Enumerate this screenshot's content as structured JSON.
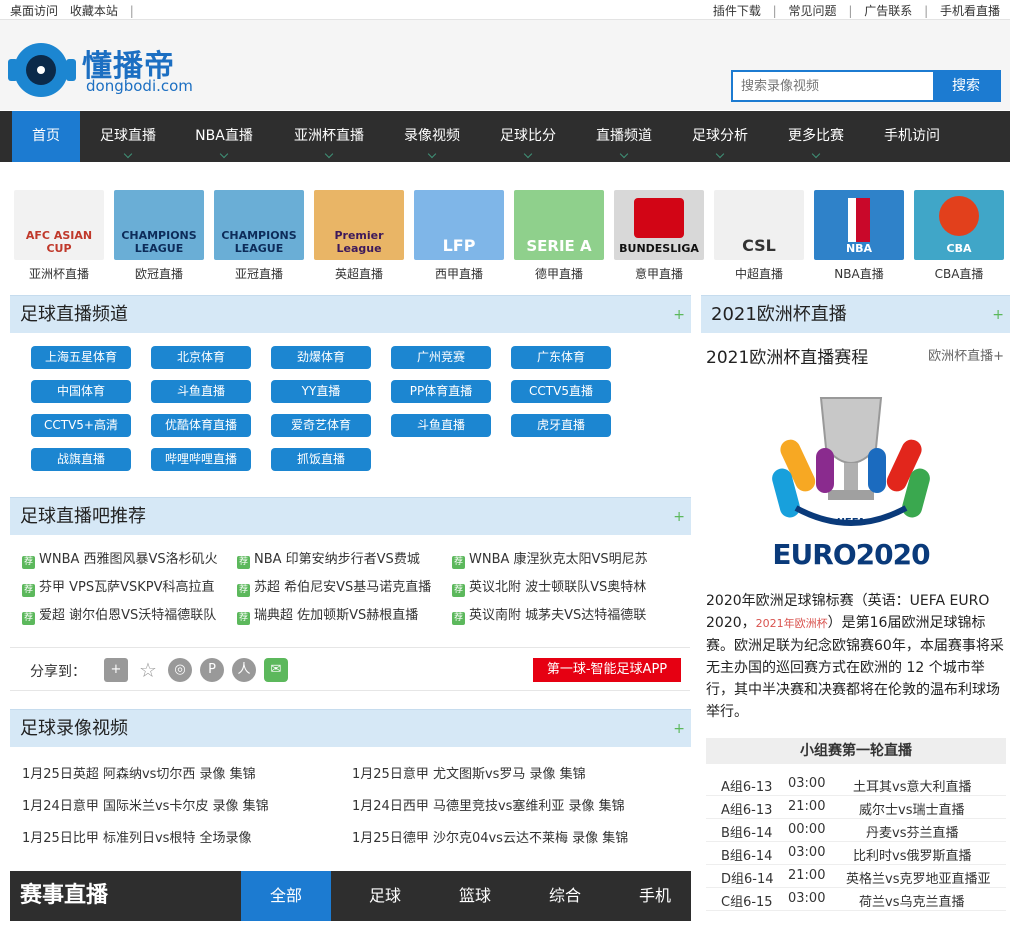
{
  "topbar": {
    "left": [
      "桌面访问",
      "收藏本站",
      "|"
    ],
    "right": [
      "插件下载",
      "|",
      "常见问题",
      "|",
      "广告联系",
      "|",
      "手机看直播"
    ]
  },
  "header": {
    "logo_cn": "懂播帝",
    "logo_en": "dongbodi.com",
    "search_placeholder": "搜索录像视频",
    "search_button": "搜索"
  },
  "nav": [
    "首页",
    "足球直播",
    "NBA直播",
    "亚洲杯直播",
    "录像视频",
    "足球比分",
    "直播频道",
    "足球分析",
    "更多比赛",
    "手机访问"
  ],
  "leagues": [
    {
      "label": "亚洲杯直播",
      "logo": "AFC ASIAN CUP",
      "bg": "#f2f2f2"
    },
    {
      "label": "欧冠直播",
      "logo": "CHAMPIONS LEAGUE",
      "bg": "#6aaed6"
    },
    {
      "label": "亚冠直播",
      "logo": "CHAMPIONS LEAGUE",
      "bg": "#6aaed6"
    },
    {
      "label": "英超直播",
      "logo": "Premier League",
      "bg": "#e9b566"
    },
    {
      "label": "西甲直播",
      "logo": "LFP",
      "bg": "#7fb6e8"
    },
    {
      "label": "德甲直播",
      "logo": "SERIE A",
      "bg": "#8fd08c"
    },
    {
      "label": "意甲直播",
      "logo": "BUNDESLIGA",
      "bg": "#d8d8d8"
    },
    {
      "label": "中超直播",
      "logo": "CSL",
      "bg": "#f0f0f0"
    },
    {
      "label": "NBA直播",
      "logo": "NBA",
      "bg": "#2f82c9"
    },
    {
      "label": "CBA直播",
      "logo": "CBA",
      "bg": "#40a6c8"
    }
  ],
  "channels": {
    "title": "足球直播频道",
    "plus": "+",
    "items": [
      "上海五星体育",
      "北京体育",
      "劲爆体育",
      "广州竞赛",
      "广东体育",
      "中国体育",
      "斗鱼直播",
      "YY直播",
      "PP体育直播",
      "CCTV5直播",
      "CCTV5+高清",
      "优酷体育直播",
      "爱奇艺体育",
      "斗鱼直播",
      "虎牙直播",
      "战旗直播",
      "哔哩哔哩直播",
      "抓饭直播"
    ]
  },
  "recommend": {
    "title": "足球直播吧推荐",
    "plus": "+",
    "icon": "荐",
    "items": [
      "WNBA 西雅图风暴VS洛杉矶火",
      "NBA 印第安纳步行者VS费城",
      "WNBA 康涅狄克太阳VS明尼苏",
      "芬甲 VPS瓦萨VSKPV科高拉直",
      "苏超 希伯尼安VS基马诺克直播",
      "英议北附 波士顿联队VS奥特林",
      "爱超 谢尔伯恩VS沃特福德联队",
      "瑞典超 佐加顿斯VS赫根直播",
      "英议南附 城茅夫VS达特福德联"
    ]
  },
  "share": {
    "label": "分享到：",
    "app": "第一球-智能足球APP"
  },
  "videos": {
    "title": "足球录像视频",
    "plus": "+",
    "items": [
      "1月25日英超 阿森纳vs切尔西 录像 集锦",
      "1月25日意甲 尤文图斯vs罗马 录像 集锦",
      "1月24日意甲 国际米兰vs卡尔皮 录像 集锦",
      "1月24日西甲 马德里竞技vs塞维利亚 录像 集锦",
      "1月25日比甲 标准列日vs根特 全场录像",
      "1月25日德甲 沙尔克04vs云达不莱梅 录像 集锦"
    ]
  },
  "live": {
    "title": "赛事直播",
    "tabs": [
      "全部",
      "足球",
      "篮球",
      "综合",
      "手机"
    ]
  },
  "euro": {
    "title": "2021欧洲杯直播",
    "plus": "+",
    "subtitle": "2021欧洲杯直播赛程",
    "more": "欧洲杯直播+",
    "logo_top": "UEFA",
    "logo_text": "EURO2020",
    "desc_a": "2020年欧洲足球锦标赛（英语：UEFA EURO 2020，",
    "desc_small": "2021年欧洲杯",
    "desc_b": "）是第16届欧洲足球锦标赛。欧洲足联为纪念欧锦赛60年，本届赛事将采无主办国的巡回赛方式在欧洲的 12 个城市举行，其中半决赛和决赛都将在伦敦的温布利球场举行。",
    "group_title": "小组赛第一轮直播",
    "matches": [
      {
        "group": "A组6-13",
        "time": "03:00",
        "teams": "土耳其vs意大利直播"
      },
      {
        "group": "A组6-13",
        "time": "21:00",
        "teams": "威尔士vs瑞士直播"
      },
      {
        "group": "B组6-14",
        "time": "00:00",
        "teams": "丹麦vs芬兰直播"
      },
      {
        "group": "B组6-14",
        "time": "03:00",
        "teams": "比利时vs俄罗斯直播"
      },
      {
        "group": "D组6-14",
        "time": "21:00",
        "teams": "英格兰vs克罗地亚直播亚"
      },
      {
        "group": "C组6-15",
        "time": "03:00",
        "teams": "荷兰vs乌克兰直播"
      }
    ]
  },
  "colors": {
    "accent": "#1c7bd1",
    "nav_bg": "#2e2e2e",
    "panel_bg": "#d6e8f6",
    "app_red": "#e60012",
    "icon_green": "#5cb85c"
  }
}
